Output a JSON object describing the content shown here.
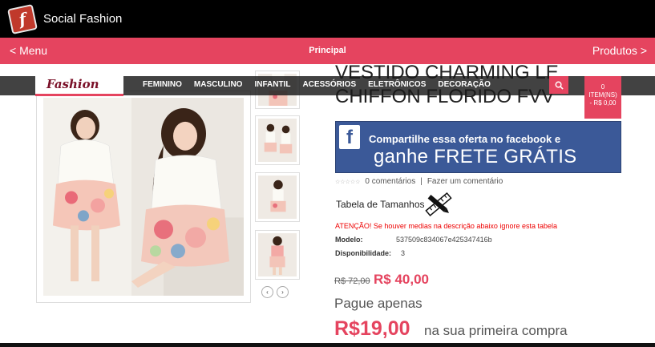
{
  "app": {
    "title": "Social Fashion",
    "logo_letter": "f"
  },
  "nav": {
    "menu": "< Menu",
    "main": "Principal",
    "products": "Produtos >"
  },
  "site": {
    "logo": "Fashion",
    "categories": [
      "FEMININO",
      "MASCULINO",
      "INFANTIL",
      "ACESSÓRIOS",
      "ELETRÔNICOS",
      "DECORAÇÃO"
    ],
    "cart": {
      "count": "0",
      "label": "ITEM(NS)",
      "total": "- R$ 0,00"
    }
  },
  "product": {
    "title_top": "VESTIDO CHARMING LE",
    "title": "CHIFFON FLORIDO FVV",
    "comments": "0 comentários",
    "separator": "|",
    "make_comment": "Fazer um comentário",
    "size_table": "Tabela de Tamanhos",
    "warning": "ATENÇÃO! Se houver medias na descrição abaixo ignore esta tabela",
    "model_label": "Modelo:",
    "model_value": "537509c834067e425347416b",
    "availability_label": "Disponibilidade:",
    "availability_value": "3",
    "old_price": "R$ 72,00",
    "price": "R$ 40,00",
    "pay_only": "Pague apenas",
    "promo_price": "R$19,00",
    "first_purchase": "na sua primeira compra"
  },
  "facebook": {
    "icon": "f",
    "line1": "Compartilhe essa oferta no facebook e",
    "line2": "ganhe FRETE GRÁTIS"
  },
  "arrows": {
    "prev": "‹",
    "next": "›"
  },
  "colors": {
    "accent": "#e5445f",
    "facebook": "#3b5998",
    "appbar": "#000000"
  }
}
